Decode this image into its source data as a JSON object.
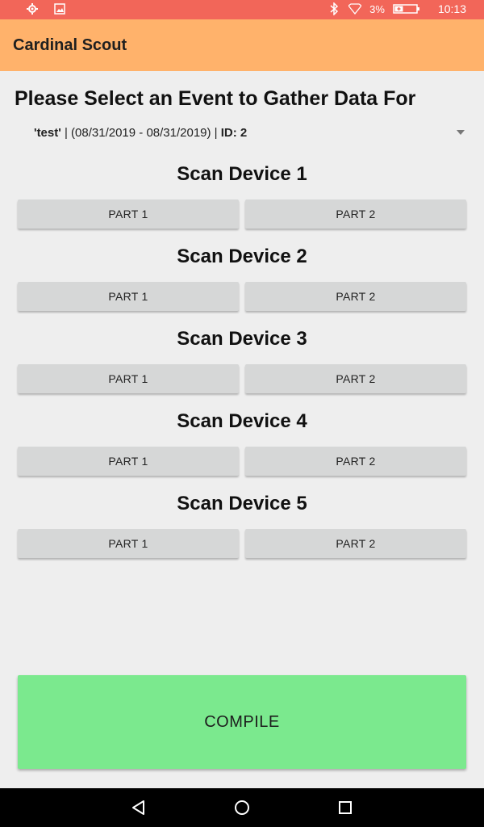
{
  "status_bar": {
    "battery": "3%",
    "time": "10:13"
  },
  "app": {
    "title": "Cardinal Scout"
  },
  "main": {
    "heading": "Please Select an Event to Gather Data For",
    "event": {
      "name": "'test'",
      "sep1": " | ",
      "dates": "(08/31/2019 - 08/31/2019)",
      "sep2": " | ",
      "id": "ID: 2"
    },
    "devices": [
      {
        "title": "Scan Device 1",
        "part1": "PART 1",
        "part2": "PART 2"
      },
      {
        "title": "Scan Device 2",
        "part1": "PART 1",
        "part2": "PART 2"
      },
      {
        "title": "Scan Device 3",
        "part1": "PART 1",
        "part2": "PART 2"
      },
      {
        "title": "Scan Device 4",
        "part1": "PART 1",
        "part2": "PART 2"
      },
      {
        "title": "Scan Device 5",
        "part1": "PART 1",
        "part2": "PART 2"
      }
    ],
    "compile_label": "COMPILE"
  },
  "colors": {
    "status_bar": "#f26659",
    "app_bar": "#ffb26b",
    "compile": "#7be98e",
    "button": "#d6d7d7"
  }
}
